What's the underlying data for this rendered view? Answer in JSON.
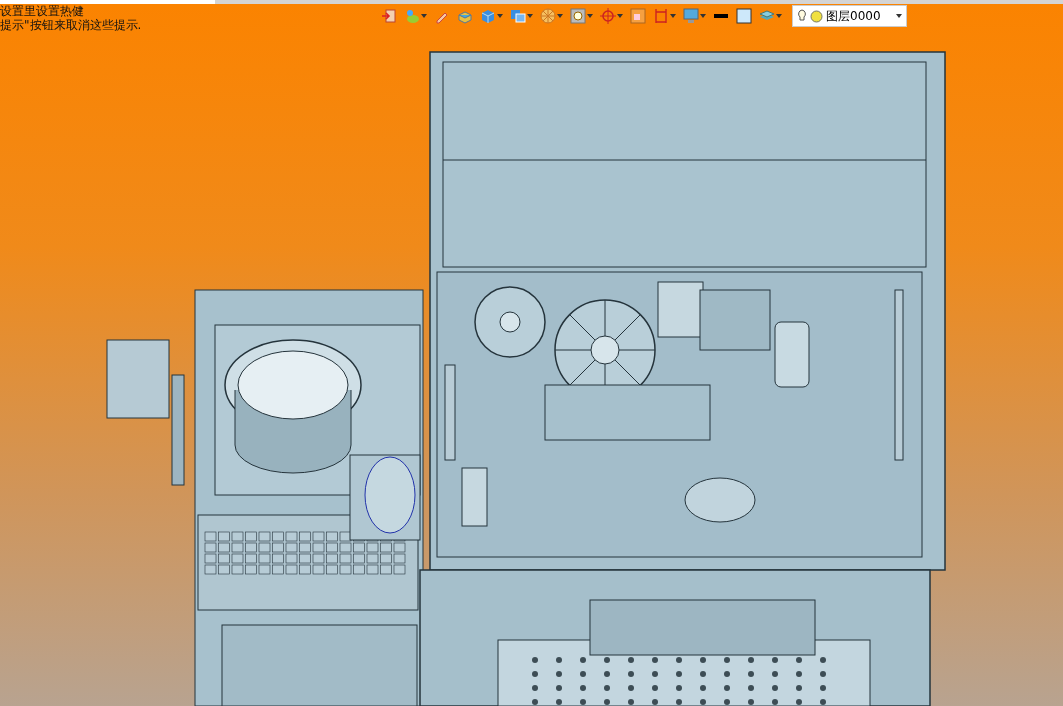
{
  "hints": [
    "设置里设置热健",
    "提示\"按钮来取消这些提示."
  ],
  "toolbar": [
    {
      "kind": "door",
      "has_menu": false
    },
    {
      "kind": "paint",
      "has_menu": true
    },
    {
      "kind": "pencil",
      "has_menu": false
    },
    {
      "kind": "box",
      "has_menu": false
    },
    {
      "kind": "cube",
      "has_menu": true
    },
    {
      "kind": "view",
      "has_menu": true
    },
    {
      "kind": "wheel",
      "has_menu": true
    },
    {
      "kind": "zoom",
      "has_menu": true
    },
    {
      "kind": "crosshair",
      "has_menu": true
    },
    {
      "kind": "frame",
      "has_menu": false
    },
    {
      "kind": "dimension",
      "has_menu": true
    },
    {
      "kind": "monitor",
      "has_menu": true
    },
    {
      "kind": "line",
      "has_menu": false
    },
    {
      "kind": "square",
      "has_menu": false
    },
    {
      "kind": "layers",
      "has_menu": true
    }
  ],
  "layer": {
    "label": "图层0000"
  }
}
